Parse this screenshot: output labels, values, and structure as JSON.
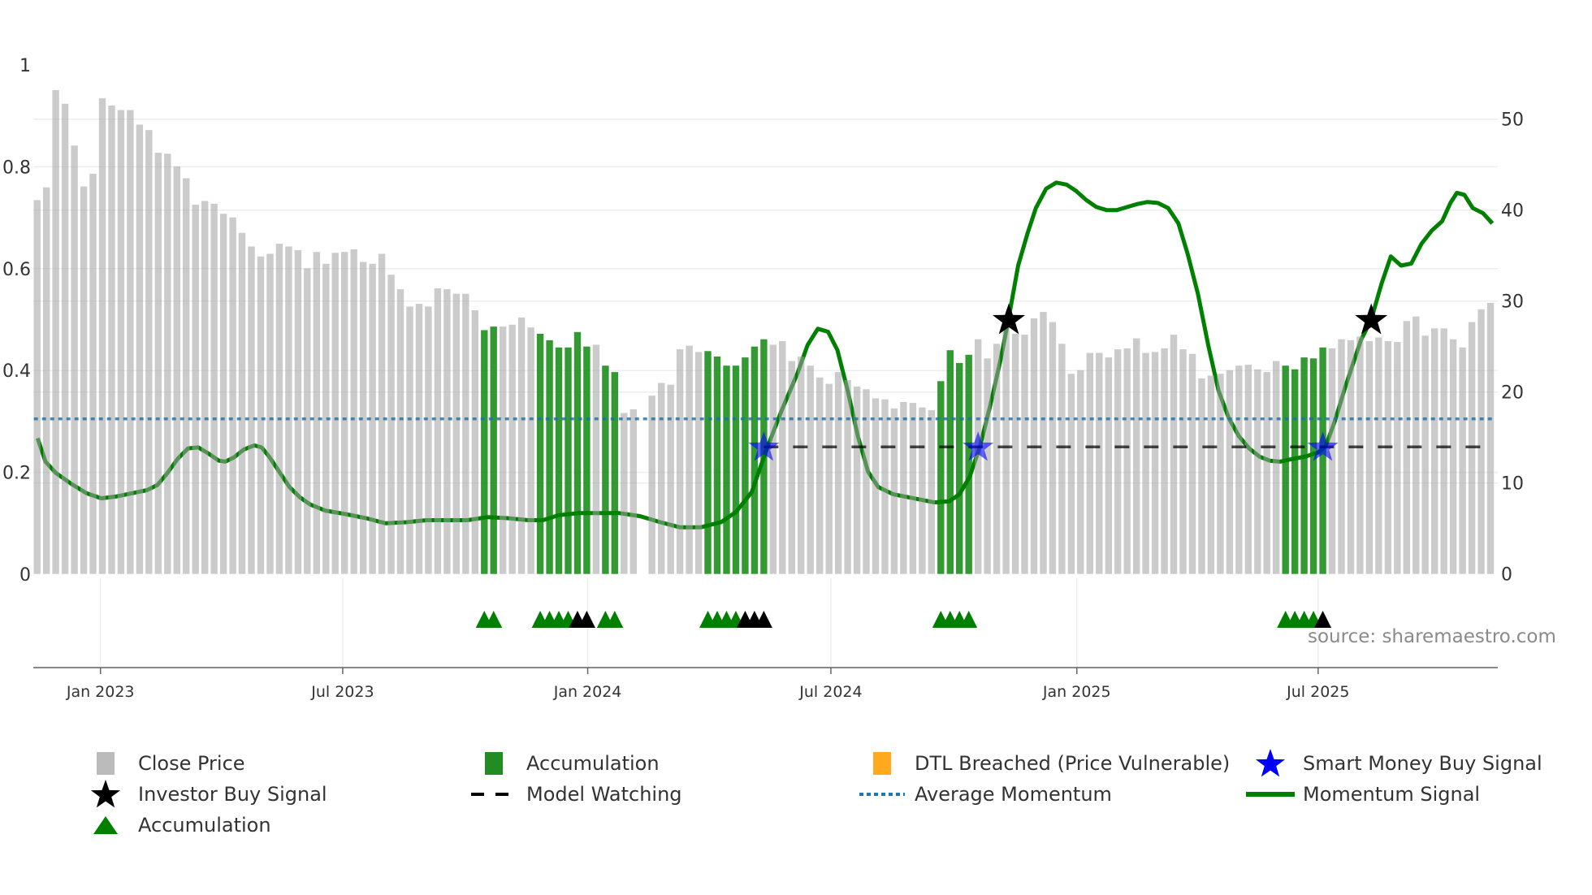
{
  "chart_data": {
    "type": "bar",
    "title": "",
    "xlabel": "",
    "y_left": {
      "label": "",
      "range": [
        0,
        1
      ],
      "ticks": [
        0,
        0.2,
        0.4,
        0.6,
        0.8,
        1
      ],
      "tick_labels": [
        "0",
        "0.2",
        "0.4",
        "0.6",
        "0.8",
        "1"
      ]
    },
    "y_right": {
      "label": "",
      "range": [
        0,
        50
      ],
      "ticks": [
        0,
        10,
        20,
        30,
        40,
        50
      ],
      "tick_labels": [
        "0",
        "10",
        "20",
        "30",
        "40",
        "50"
      ]
    },
    "x_axis": {
      "unit": "week index",
      "ticks": [
        {
          "label": "Jan 2023",
          "week": 6.8
        },
        {
          "label": "Jul 2023",
          "week": 32.8
        },
        {
          "label": "Jan 2024",
          "week": 59.1
        },
        {
          "label": "Jul 2024",
          "week": 85.2
        },
        {
          "label": "Jan 2025",
          "week": 111.6
        },
        {
          "label": "Jul 2025",
          "week": 137.5
        }
      ]
    },
    "grid": true,
    "legend_position": "bottom",
    "close_price": [
      41.1,
      42.5,
      53.2,
      51.7,
      47.1,
      42.6,
      44.0,
      52.3,
      51.5,
      51.0,
      51.0,
      49.4,
      48.8,
      46.3,
      46.2,
      44.8,
      43.5,
      40.6,
      41.0,
      40.7,
      39.6,
      39.2,
      37.5,
      36.0,
      34.9,
      35.2,
      36.3,
      36.0,
      35.6,
      33.6,
      35.4,
      34.1,
      35.3,
      35.4,
      35.7,
      34.3,
      34.1,
      35.2,
      32.9,
      31.3,
      29.4,
      29.7,
      29.4,
      31.4,
      31.3,
      30.8,
      30.8,
      29.0,
      26.8,
      27.2,
      27.2,
      27.4,
      28.2,
      27.1,
      26.4,
      25.7,
      24.9,
      24.9,
      26.6,
      25.0,
      25.2,
      22.9,
      22.2,
      17.7,
      18.1,
      null,
      19.6,
      21.0,
      20.8,
      24.7,
      25.1,
      24.4,
      24.5,
      23.9,
      22.9,
      22.9,
      23.8,
      25.0,
      25.8,
      25.2,
      25.6,
      23.4,
      23.9,
      22.9,
      21.6,
      20.9,
      22.2,
      21.3,
      20.6,
      20.3,
      19.3,
      19.2,
      18.2,
      18.9,
      18.8,
      18.3,
      18.0,
      21.2,
      24.6,
      23.2,
      24.1,
      25.8,
      23.7,
      25.3,
      28.4,
      26.4,
      26.3,
      28.1,
      28.8,
      27.7,
      25.3,
      22.0,
      22.4,
      24.3,
      24.3,
      23.8,
      24.7,
      24.8,
      25.9,
      24.3,
      24.4,
      24.8,
      26.3,
      24.7,
      24.2,
      21.5,
      21.8,
      22.0,
      22.4,
      22.9,
      23.0,
      22.5,
      22.2,
      23.4,
      22.9,
      22.5,
      23.8,
      23.7,
      24.9,
      24.8,
      25.8,
      25.7,
      26.1,
      25.6,
      26.0,
      25.6,
      25.5,
      27.8,
      28.3,
      26.2,
      27.0,
      27.0,
      25.8,
      24.9,
      27.7,
      29.1,
      29.8
    ],
    "accumulation_bars": [
      48,
      49,
      54,
      55,
      56,
      57,
      58,
      59,
      61,
      62,
      72,
      73,
      74,
      75,
      76,
      77,
      78,
      97,
      98,
      99,
      100,
      134,
      135,
      136,
      137,
      138
    ],
    "momentum_signal": [
      [
        0.05,
        0.267
      ],
      [
        0.9,
        0.221
      ],
      [
        2.0,
        0.199
      ],
      [
        3.7,
        0.177
      ],
      [
        5.3,
        0.159
      ],
      [
        6.9,
        0.149
      ],
      [
        8.6,
        0.153
      ],
      [
        10.2,
        0.159
      ],
      [
        11.8,
        0.165
      ],
      [
        12.9,
        0.175
      ],
      [
        14.0,
        0.199
      ],
      [
        15.1,
        0.227
      ],
      [
        16.2,
        0.247
      ],
      [
        17.3,
        0.249
      ],
      [
        18.4,
        0.237
      ],
      [
        19.5,
        0.223
      ],
      [
        20.2,
        0.221
      ],
      [
        21.1,
        0.229
      ],
      [
        22.2,
        0.245
      ],
      [
        23.3,
        0.253
      ],
      [
        24.1,
        0.249
      ],
      [
        24.9,
        0.231
      ],
      [
        26.0,
        0.201
      ],
      [
        27.1,
        0.171
      ],
      [
        28.2,
        0.151
      ],
      [
        29.3,
        0.137
      ],
      [
        30.9,
        0.125
      ],
      [
        33.1,
        0.118
      ],
      [
        35.3,
        0.11
      ],
      [
        37.4,
        0.1
      ],
      [
        39.6,
        0.102
      ],
      [
        41.8,
        0.106
      ],
      [
        44.0,
        0.106
      ],
      [
        46.2,
        0.106
      ],
      [
        48.3,
        0.112
      ],
      [
        50.5,
        0.11
      ],
      [
        52.7,
        0.106
      ],
      [
        54.3,
        0.106
      ],
      [
        56.0,
        0.116
      ],
      [
        58.1,
        0.12
      ],
      [
        60.3,
        0.12
      ],
      [
        62.5,
        0.12
      ],
      [
        64.7,
        0.114
      ],
      [
        66.9,
        0.102
      ],
      [
        69.0,
        0.092
      ],
      [
        71.2,
        0.092
      ],
      [
        73.4,
        0.102
      ],
      [
        75.0,
        0.122
      ],
      [
        76.7,
        0.161
      ],
      [
        78.3,
        0.245
      ],
      [
        79.9,
        0.321
      ],
      [
        81.6,
        0.394
      ],
      [
        82.7,
        0.45
      ],
      [
        83.8,
        0.482
      ],
      [
        84.9,
        0.476
      ],
      [
        85.9,
        0.44
      ],
      [
        87.0,
        0.361
      ],
      [
        88.1,
        0.271
      ],
      [
        89.2,
        0.201
      ],
      [
        90.3,
        0.171
      ],
      [
        91.9,
        0.157
      ],
      [
        94.1,
        0.149
      ],
      [
        96.3,
        0.141
      ],
      [
        97.9,
        0.143
      ],
      [
        99.0,
        0.157
      ],
      [
        100.1,
        0.191
      ],
      [
        101.2,
        0.251
      ],
      [
        102.3,
        0.331
      ],
      [
        103.4,
        0.42
      ],
      [
        104.3,
        0.504
      ],
      [
        105.3,
        0.606
      ],
      [
        106.3,
        0.669
      ],
      [
        107.2,
        0.719
      ],
      [
        108.3,
        0.757
      ],
      [
        109.4,
        0.769
      ],
      [
        110.5,
        0.765
      ],
      [
        111.5,
        0.753
      ],
      [
        112.6,
        0.735
      ],
      [
        113.7,
        0.721
      ],
      [
        114.8,
        0.715
      ],
      [
        115.9,
        0.715
      ],
      [
        117.0,
        0.721
      ],
      [
        118.1,
        0.727
      ],
      [
        119.2,
        0.731
      ],
      [
        120.3,
        0.729
      ],
      [
        121.4,
        0.719
      ],
      [
        122.5,
        0.689
      ],
      [
        123.5,
        0.629
      ],
      [
        124.6,
        0.55
      ],
      [
        125.7,
        0.45
      ],
      [
        126.8,
        0.361
      ],
      [
        127.9,
        0.307
      ],
      [
        129.0,
        0.271
      ],
      [
        130.1,
        0.247
      ],
      [
        131.2,
        0.231
      ],
      [
        132.3,
        0.223
      ],
      [
        133.4,
        0.221
      ],
      [
        134.4,
        0.225
      ],
      [
        136.1,
        0.231
      ],
      [
        137.5,
        0.239
      ],
      [
        138.3,
        0.251
      ],
      [
        139.3,
        0.301
      ],
      [
        140.4,
        0.367
      ],
      [
        142.1,
        0.46
      ],
      [
        143.2,
        0.5
      ],
      [
        144.3,
        0.57
      ],
      [
        145.3,
        0.624
      ],
      [
        146.4,
        0.606
      ],
      [
        147.5,
        0.61
      ],
      [
        148.6,
        0.649
      ],
      [
        149.7,
        0.675
      ],
      [
        150.8,
        0.693
      ],
      [
        151.7,
        0.729
      ],
      [
        152.4,
        0.749
      ],
      [
        153.2,
        0.745
      ],
      [
        154.1,
        0.719
      ],
      [
        155.2,
        0.709
      ],
      [
        156.2,
        0.689
      ]
    ],
    "average_momentum": 0.305,
    "model_watching": {
      "level": 0.25,
      "from_week": 78,
      "to_week": 155.6
    },
    "smart_money_buy_signals": [
      [
        78,
        0.25
      ],
      [
        101,
        0.25
      ],
      [
        138,
        0.25
      ]
    ],
    "investor_buy_signals": [
      [
        104.3,
        0.5
      ],
      [
        143.2,
        0.5
      ]
    ],
    "accumulation_triangles_green": [
      48,
      49,
      54,
      55,
      56,
      57,
      61,
      62,
      72,
      73,
      74,
      75,
      97,
      98,
      99,
      100,
      134,
      135,
      136,
      137
    ],
    "accumulation_triangles_black": [
      58,
      59,
      76,
      77,
      78,
      138
    ],
    "colors": {
      "close_price": "#a0a0a0",
      "accumulation": "#008000",
      "dtl": "#ffa91f",
      "smart_money": "#0000ff",
      "investor": "#000000",
      "avg_momentum": "#1f6fa8",
      "momentum": "#008000"
    },
    "legend": [
      {
        "label": "Close Price",
        "icon": "gray-square"
      },
      {
        "label": "Accumulation",
        "icon": "green-square"
      },
      {
        "label": "DTL Breached (Price Vulnerable)",
        "icon": "orange-square"
      },
      {
        "label": "Smart Money Buy Signal",
        "icon": "blue-star"
      },
      {
        "label": "Investor Buy Signal",
        "icon": "black-star"
      },
      {
        "label": "Model Watching",
        "icon": "black-dash"
      },
      {
        "label": "Average Momentum",
        "icon": "blue-dotted"
      },
      {
        "label": "Momentum Signal",
        "icon": "green-line"
      },
      {
        "label": "Accumulation",
        "icon": "green-triangle"
      }
    ],
    "source": "source: sharemaestro.com"
  }
}
